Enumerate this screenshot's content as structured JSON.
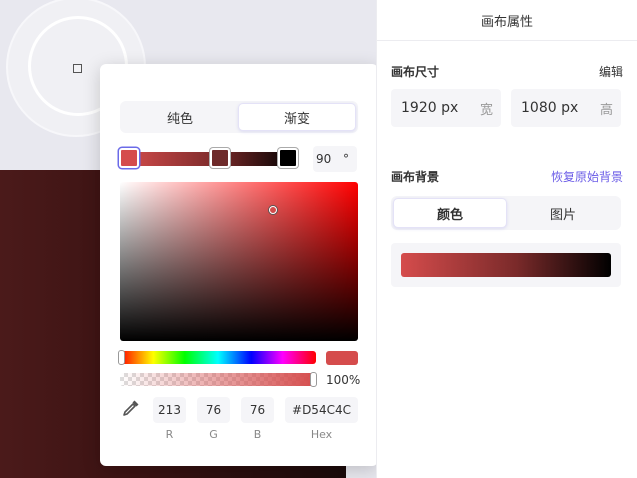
{
  "colors": {
    "selected": "#D54C4C",
    "stop_mid": "#6E2A2A",
    "stop_end": "#000000",
    "accent": "#6B5CE7"
  },
  "picker": {
    "tabs": [
      {
        "label": "纯色",
        "active": false
      },
      {
        "label": "渐变",
        "active": true
      }
    ],
    "angle": "90",
    "angle_unit": "°",
    "alpha": "100%",
    "r": "213",
    "g": "76",
    "b": "76",
    "hex": "#D54C4C",
    "labels": {
      "r": "R",
      "g": "G",
      "b": "B",
      "hex": "Hex"
    },
    "eyedropper_icon": "eyedropper-icon"
  },
  "panel": {
    "title": "画布属性",
    "size": {
      "title": "画布尺寸",
      "edit_label": "编辑",
      "width_value": "1920 px",
      "width_label": "宽",
      "height_value": "1080 px",
      "height_label": "高"
    },
    "background": {
      "title": "画布背景",
      "reset_label": "恢复原始背景",
      "tabs": [
        {
          "label": "颜色",
          "active": true
        },
        {
          "label": "图片",
          "active": false
        }
      ]
    }
  }
}
